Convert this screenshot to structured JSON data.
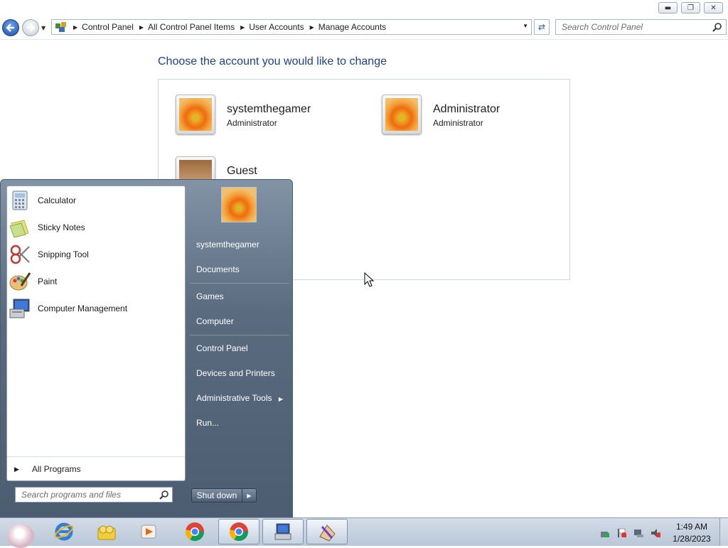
{
  "window": {
    "minimize_icon": "minimize-icon",
    "maximize_icon": "restore-icon",
    "close_icon": "close-icon"
  },
  "address_bar": {
    "crumbs": [
      "Control Panel",
      "All Control Panel Items",
      "User Accounts",
      "Manage Accounts"
    ],
    "search_placeholder": "Search Control Panel"
  },
  "content": {
    "heading": "Choose the account you would like to change",
    "accounts": [
      {
        "name": "systemthegamer",
        "role": "Administrator",
        "picture": "flower"
      },
      {
        "name": "Administrator",
        "role": "Administrator",
        "picture": "flower"
      },
      {
        "name": "Guest",
        "role": "",
        "picture": "briefcase"
      }
    ]
  },
  "start_menu": {
    "programs": [
      {
        "label": "Calculator",
        "icon": "calculator-icon"
      },
      {
        "label": "Sticky Notes",
        "icon": "sticky-notes-icon"
      },
      {
        "label": "Snipping Tool",
        "icon": "scissors-icon"
      },
      {
        "label": "Paint",
        "icon": "paint-palette-icon"
      },
      {
        "label": "Computer Management",
        "icon": "computer-management-icon"
      }
    ],
    "all_programs": "All Programs",
    "search_placeholder": "Search programs and files",
    "right_items": [
      {
        "label": "systemthegamer"
      },
      {
        "label": "Documents"
      },
      {
        "label": "Games"
      },
      {
        "label": "Computer"
      },
      {
        "label": "Control Panel"
      },
      {
        "label": "Devices and Printers"
      },
      {
        "label": "Administrative Tools"
      },
      {
        "label": "Run..."
      }
    ],
    "shutdown": "Shut down"
  },
  "taskbar": {
    "pinned": [
      "internet-explorer-icon",
      "explorer-icon",
      "media-player-icon",
      "chrome-icon",
      "chrome-icon",
      "control-panel-icon",
      "user-accounts-icon"
    ],
    "time": "1:49 AM",
    "date": "1/28/2023"
  }
}
